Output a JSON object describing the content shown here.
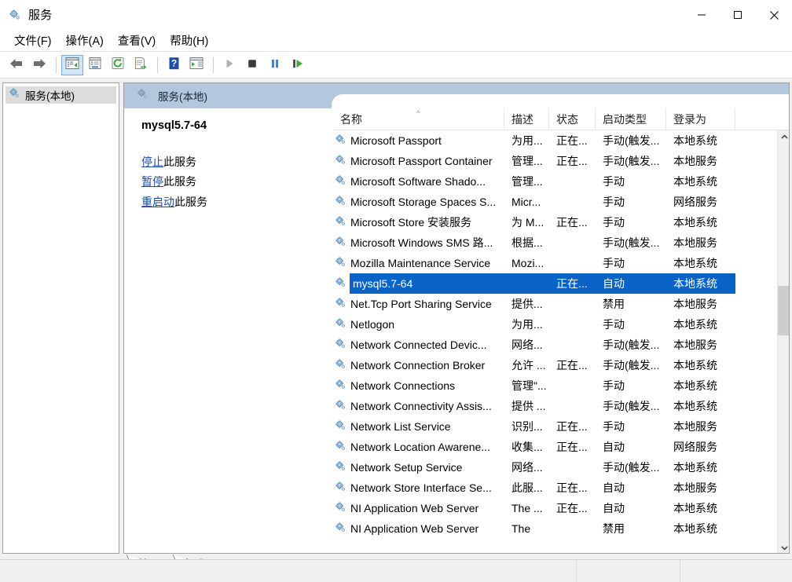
{
  "window": {
    "title": "服务",
    "icon": "services-gear-icon",
    "minimize_label": "最小化",
    "maximize_label": "最大化",
    "close_label": "关闭"
  },
  "menu": {
    "items": [
      {
        "label": "文件(F)",
        "name": "menu-file"
      },
      {
        "label": "操作(A)",
        "name": "menu-action"
      },
      {
        "label": "查看(V)",
        "name": "menu-view"
      },
      {
        "label": "帮助(H)",
        "name": "menu-help"
      }
    ]
  },
  "toolbar": {
    "buttons": [
      {
        "name": "back-button",
        "icon": "arrow-left-icon",
        "active": false
      },
      {
        "name": "forward-button",
        "icon": "arrow-right-icon",
        "active": false
      },
      {
        "name": "show-hide-tree-button",
        "icon": "console-tree-icon",
        "active": true
      },
      {
        "name": "properties-button",
        "icon": "properties-window-icon",
        "active": false
      },
      {
        "name": "refresh-button",
        "icon": "refresh-green-icon",
        "active": false
      },
      {
        "name": "export-list-button",
        "icon": "export-list-icon",
        "active": false
      },
      {
        "name": "help-button",
        "icon": "help-question-icon",
        "active": false
      },
      {
        "name": "show-action-pane-button",
        "icon": "action-pane-icon",
        "active": false
      },
      {
        "name": "start-service-button",
        "icon": "play-triangle-icon",
        "active": false
      },
      {
        "name": "stop-service-button",
        "icon": "stop-square-icon",
        "active": false
      },
      {
        "name": "pause-service-button",
        "icon": "pause-bars-icon",
        "active": false
      },
      {
        "name": "restart-service-button",
        "icon": "restart-icon",
        "active": false
      }
    ]
  },
  "tree": {
    "root_label": "服务(本地)",
    "root_icon": "services-gear-icon"
  },
  "band": {
    "label": "服务(本地)",
    "icon": "services-gear-icon"
  },
  "detail": {
    "service_name": "mysql5.7-64",
    "links": [
      {
        "link_text": "停止",
        "suffix": "此服务",
        "name": "stop-service-link"
      },
      {
        "link_text": "暂停",
        "suffix": "此服务",
        "name": "pause-service-link"
      },
      {
        "link_text": "重启动",
        "suffix": "此服务",
        "name": "restart-service-link"
      }
    ]
  },
  "list": {
    "columns": [
      {
        "label": "名称",
        "name": "column-name",
        "sorted": true,
        "sort_arrow": "^"
      },
      {
        "label": "描述",
        "name": "column-description",
        "sorted": false
      },
      {
        "label": "状态",
        "name": "column-status",
        "sorted": false
      },
      {
        "label": "启动类型",
        "name": "column-startup-type",
        "sorted": false
      },
      {
        "label": "登录为",
        "name": "column-log-on-as",
        "sorted": false
      }
    ],
    "rows": [
      {
        "name": "Microsoft Passport",
        "description": "为用...",
        "status": "正在...",
        "startup": "手动(触发...",
        "logon": "本地系统",
        "selected": false
      },
      {
        "name": "Microsoft Passport Container",
        "description": "管理...",
        "status": "正在...",
        "startup": "手动(触发...",
        "logon": "本地服务",
        "selected": false
      },
      {
        "name": "Microsoft Software Shado...",
        "description": "管理...",
        "status": "",
        "startup": "手动",
        "logon": "本地系统",
        "selected": false
      },
      {
        "name": "Microsoft Storage Spaces S...",
        "description": "Micr...",
        "status": "",
        "startup": "手动",
        "logon": "网络服务",
        "selected": false
      },
      {
        "name": "Microsoft Store 安装服务",
        "description": "为 M...",
        "status": "正在...",
        "startup": "手动",
        "logon": "本地系统",
        "selected": false
      },
      {
        "name": "Microsoft Windows SMS 路...",
        "description": "根据...",
        "status": "",
        "startup": "手动(触发...",
        "logon": "本地服务",
        "selected": false
      },
      {
        "name": "Mozilla Maintenance Service",
        "description": "Mozi...",
        "status": "",
        "startup": "手动",
        "logon": "本地系统",
        "selected": false
      },
      {
        "name": "mysql5.7-64",
        "description": "",
        "status": "正在...",
        "startup": "自动",
        "logon": "本地系统",
        "selected": true
      },
      {
        "name": "Net.Tcp Port Sharing Service",
        "description": "提供...",
        "status": "",
        "startup": "禁用",
        "logon": "本地服务",
        "selected": false
      },
      {
        "name": "Netlogon",
        "description": "为用...",
        "status": "",
        "startup": "手动",
        "logon": "本地系统",
        "selected": false
      },
      {
        "name": "Network Connected Devic...",
        "description": "网络...",
        "status": "",
        "startup": "手动(触发...",
        "logon": "本地服务",
        "selected": false
      },
      {
        "name": "Network Connection Broker",
        "description": "允许 ...",
        "status": "正在...",
        "startup": "手动(触发...",
        "logon": "本地系统",
        "selected": false
      },
      {
        "name": "Network Connections",
        "description": "管理\"...",
        "status": "",
        "startup": "手动",
        "logon": "本地系统",
        "selected": false
      },
      {
        "name": "Network Connectivity Assis...",
        "description": "提供 ...",
        "status": "",
        "startup": "手动(触发...",
        "logon": "本地系统",
        "selected": false
      },
      {
        "name": "Network List Service",
        "description": "识别...",
        "status": "正在...",
        "startup": "手动",
        "logon": "本地服务",
        "selected": false
      },
      {
        "name": "Network Location Awarene...",
        "description": "收集...",
        "status": "正在...",
        "startup": "自动",
        "logon": "网络服务",
        "selected": false
      },
      {
        "name": "Network Setup Service",
        "description": "网络...",
        "status": "",
        "startup": "手动(触发...",
        "logon": "本地系统",
        "selected": false
      },
      {
        "name": "Network Store Interface Se...",
        "description": "此服...",
        "status": "正在...",
        "startup": "自动",
        "logon": "本地服务",
        "selected": false
      },
      {
        "name": "NI Application Web Server",
        "description": "The ...",
        "status": "正在...",
        "startup": "自动",
        "logon": "本地系统",
        "selected": false
      },
      {
        "name": "NI Application Web Server",
        "description": "The ",
        "status": "",
        "startup": "禁用",
        "logon": "本地系统",
        "selected": false
      }
    ],
    "scroll_up_arrow": "^",
    "scroll_down_arrow": "v",
    "row_icon": "service-gear-icon"
  },
  "tabs": [
    {
      "label": "扩展",
      "name": "tab-extended",
      "active": false
    },
    {
      "label": "标准",
      "name": "tab-standard",
      "active": true
    }
  ],
  "statusbar": {
    "text": ""
  },
  "colors": {
    "selection_blue": "#0a64c8",
    "band_blue": "#b3c7dd",
    "link_blue": "#1a4b9c",
    "toolbar_active": "#cfe6f7",
    "window_bg": "#f0f0f0"
  }
}
